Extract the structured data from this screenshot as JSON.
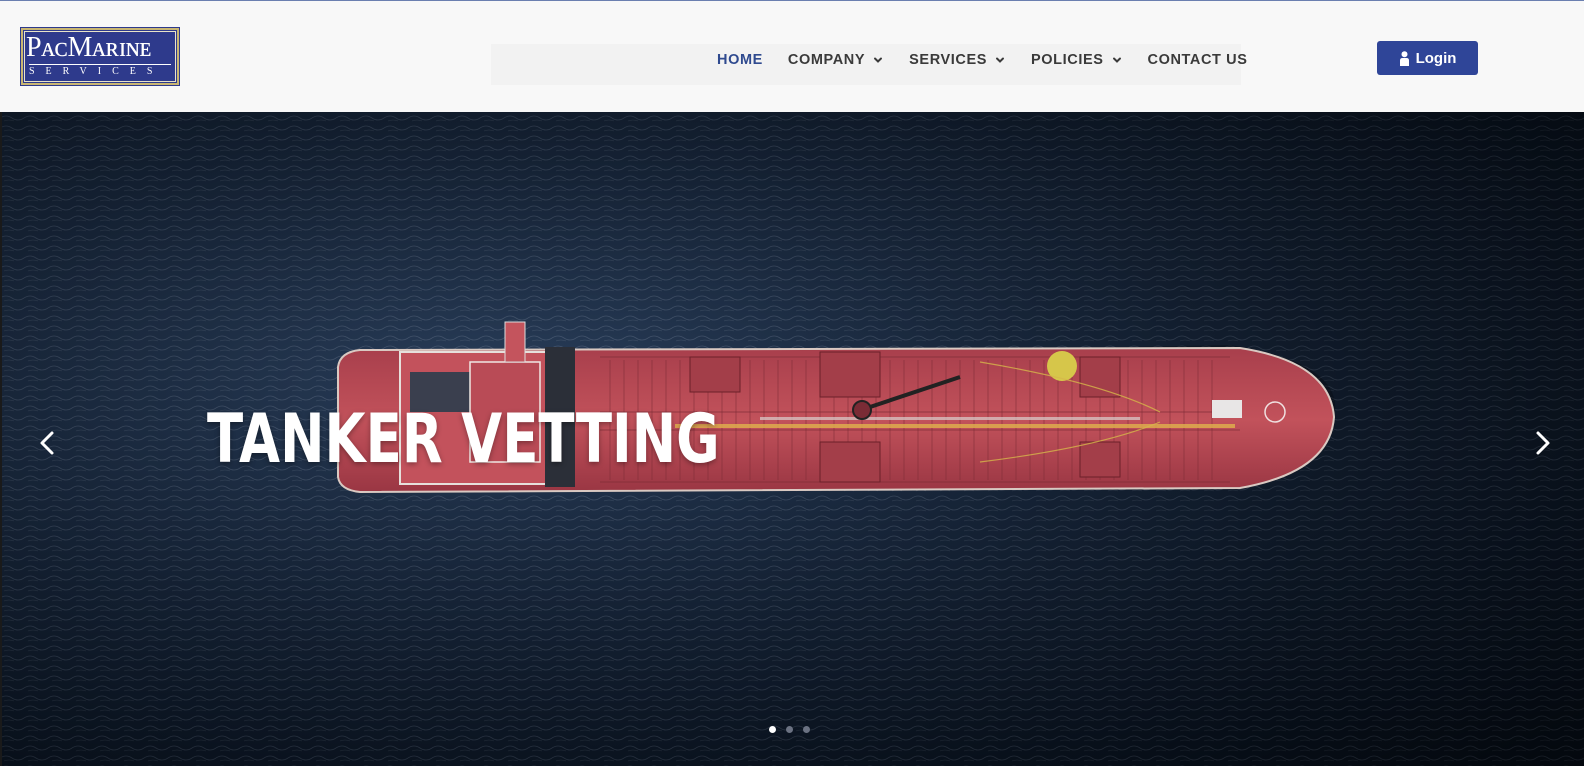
{
  "brand": {
    "logo_main": "PacMarine",
    "logo_main_display": "PᴀᴄMᴀʀɪɴᴇ",
    "logo_sub": "SERVICES"
  },
  "nav": {
    "items": [
      {
        "label": "HOME",
        "active": true,
        "dropdown": false
      },
      {
        "label": "COMPANY",
        "active": false,
        "dropdown": true
      },
      {
        "label": "SERVICES",
        "active": false,
        "dropdown": true
      },
      {
        "label": "POLICIES",
        "active": false,
        "dropdown": true
      },
      {
        "label": "CONTACT US",
        "active": false,
        "dropdown": false
      }
    ],
    "login_label": "Login"
  },
  "hero": {
    "title": "TANKER VETTING",
    "slide_count": 3,
    "active_slide": 1
  },
  "colors": {
    "header_bg": "#f8f8f8",
    "nav_active": "#2f4a8f",
    "nav_text": "#3a3a3a",
    "login_bg": "#2f4598",
    "logo_bg": "#2e3a8c",
    "logo_border": "#c9b673",
    "ship_hull": "#b84a55",
    "sea": "#1b2c44"
  },
  "icons": {
    "login": "user-icon",
    "dropdown": "chevron-down-icon",
    "prev": "chevron-left-icon",
    "next": "chevron-right-icon"
  }
}
